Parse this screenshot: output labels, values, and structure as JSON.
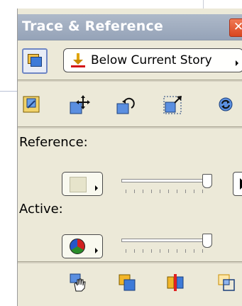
{
  "palette": {
    "title": "Trace & Reference",
    "close_label": "✕"
  },
  "layer_row": {
    "placement_value": "Below Current Story",
    "placement_icon": "arrow-down-to-line-icon",
    "layer_toggle_icon": "stacked-squares-icon"
  },
  "tools": [
    {
      "name": "toggle-trace-icon"
    },
    {
      "name": "move-trace-icon"
    },
    {
      "name": "rotate-trace-icon"
    },
    {
      "name": "resize-trace-icon"
    },
    {
      "name": "reset-trace-icon"
    }
  ],
  "reference": {
    "label": "Reference:",
    "swatch_color": "#e6e4cb",
    "opacity_level": 0.95
  },
  "active": {
    "label": "Active:",
    "swatch_icon": "color-pie-icon",
    "opacity_level": 0.95
  },
  "bottom_tools": [
    {
      "name": "hand-pan-icon"
    },
    {
      "name": "overlap-squares-icon"
    },
    {
      "name": "split-compare-icon"
    },
    {
      "name": "outline-squares-icon"
    }
  ],
  "colors": {
    "titlebar": "#a2afc2",
    "panel": "#ece9d8",
    "close": "#e0532b"
  }
}
